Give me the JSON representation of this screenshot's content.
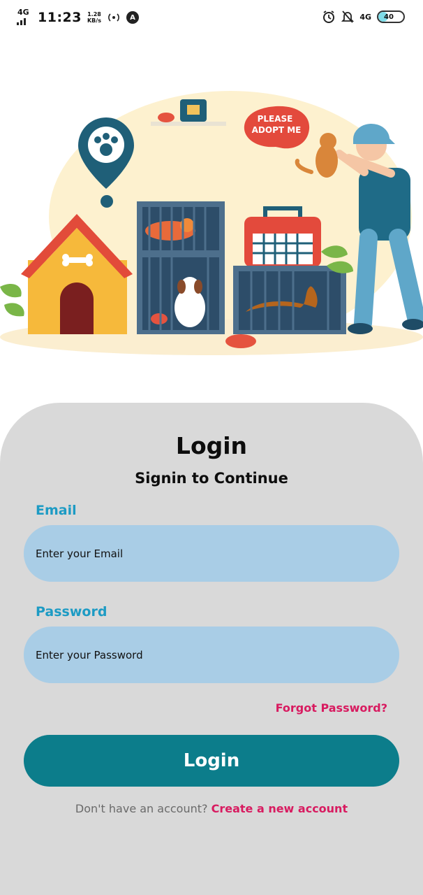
{
  "status_bar": {
    "network_left": "4G",
    "time": "11:23",
    "speed_value": "1.28",
    "speed_unit": "KB/s",
    "network_right": "4G",
    "battery": "40",
    "icons": [
      "signal-icon",
      "hotspot-icon",
      "app-notification-icon",
      "alarm-icon",
      "mute-icon",
      "battery-icon"
    ]
  },
  "illustration": {
    "speech_bubble_line1": "PLEASE",
    "speech_bubble_line2": "ADOPT ME"
  },
  "login": {
    "title": "Login",
    "subtitle": "Signin to Continue",
    "email_label": "Email",
    "email_placeholder": "Enter your Email",
    "email_value": "",
    "password_label": "Password",
    "password_placeholder": "Enter your Password",
    "password_value": "",
    "forgot_password": "Forgot Password?",
    "login_button": "Login",
    "signup_prompt": "Don't have an account?",
    "signup_link": "Create a new account"
  },
  "colors": {
    "card_background": "#d9d9d9",
    "input_background": "#a9cde6",
    "label_color": "#1d9bc4",
    "accent_pink": "#d81b60",
    "button_teal": "#0c7d8b"
  }
}
